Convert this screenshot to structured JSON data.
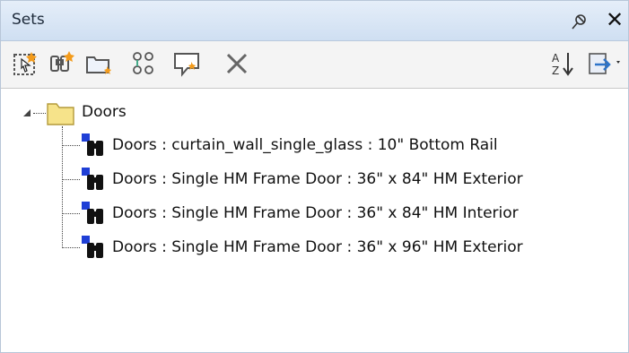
{
  "panel": {
    "title": "Sets",
    "pin_icon": "pin-icon",
    "close_icon": "close-icon",
    "close_label": "✕"
  },
  "toolbar": {
    "buttons": [
      {
        "icon": "save-selection-icon"
      },
      {
        "icon": "save-search-icon"
      },
      {
        "icon": "new-folder-icon"
      },
      {
        "icon": "duplicate-icon"
      },
      {
        "icon": "add-comment-icon"
      },
      {
        "icon": "delete-icon"
      },
      {
        "icon": "sort-icon"
      },
      {
        "icon": "import-export-icon"
      }
    ]
  },
  "tree": {
    "folder": {
      "label": "Doors",
      "expanded": true
    },
    "items": [
      {
        "label": "Doors : curtain_wall_single_glass : 10\" Bottom Rail"
      },
      {
        "label": "Doors : Single HM Frame Door : 36\" x 84\" HM Exterior"
      },
      {
        "label": "Doors : Single HM Frame Door : 36\" x 84\" HM Interior"
      },
      {
        "label": "Doors : Single HM Frame Door : 36\" x 96\" HM Exterior"
      }
    ]
  },
  "colors": {
    "titlebar": "#dbe7f5",
    "search_icon_blue": "#1f3fd6",
    "folder": "#f6e38a"
  }
}
